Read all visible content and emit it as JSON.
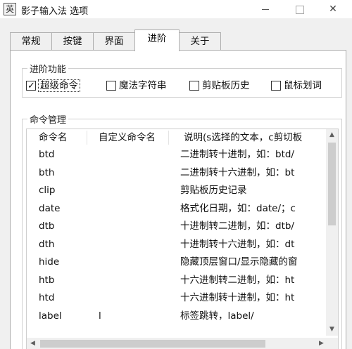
{
  "window": {
    "title": "影子输入法 选项",
    "icon_glyph": "英",
    "icon": "app-icon",
    "controls": [
      "minimize-icon",
      "maximize-icon",
      "close-icon"
    ],
    "close_glyph": "✕"
  },
  "tabs": [
    {
      "label": "常规",
      "active": false
    },
    {
      "label": "按键",
      "active": false
    },
    {
      "label": "界面",
      "active": false
    },
    {
      "label": "进阶",
      "active": true
    },
    {
      "label": "关于",
      "active": false
    }
  ],
  "features": {
    "legend": "进阶功能",
    "options": [
      {
        "label": "超级命令",
        "checked": true
      },
      {
        "label": "魔法字符串",
        "checked": false
      },
      {
        "label": "剪贴板历史",
        "checked": false
      },
      {
        "label": "鼠标划词",
        "checked": false
      }
    ]
  },
  "command_manager": {
    "legend": "命令管理",
    "columns": [
      "命令名",
      "自定义命令名",
      "说明(s选择的文本，c剪切板"
    ],
    "rows": [
      {
        "name": "btd",
        "custom": "",
        "desc": "二进制转十进制，如：btd/"
      },
      {
        "name": "bth",
        "custom": "",
        "desc": "二进制转十六进制，如：bt"
      },
      {
        "name": "clip",
        "custom": "",
        "desc": "剪贴板历史记录"
      },
      {
        "name": "date",
        "custom": "",
        "desc": "格式化日期，如：date/；c"
      },
      {
        "name": "dtb",
        "custom": "",
        "desc": "十进制转二进制，如：dtb/"
      },
      {
        "name": "dth",
        "custom": "",
        "desc": "十进制转十六进制，如：dt"
      },
      {
        "name": "hide",
        "custom": "",
        "desc": "隐藏顶层窗口/显示隐藏的窗"
      },
      {
        "name": "htb",
        "custom": "",
        "desc": "十六进制转二进制，如：ht"
      },
      {
        "name": "htd",
        "custom": "",
        "desc": "十六进制转十进制，如：ht"
      },
      {
        "name": "label",
        "custom": "l",
        "desc": "标签跳转，label/"
      }
    ],
    "scroll": {
      "up": "▲",
      "down": "▼",
      "left": "◀",
      "right": "▶"
    }
  }
}
